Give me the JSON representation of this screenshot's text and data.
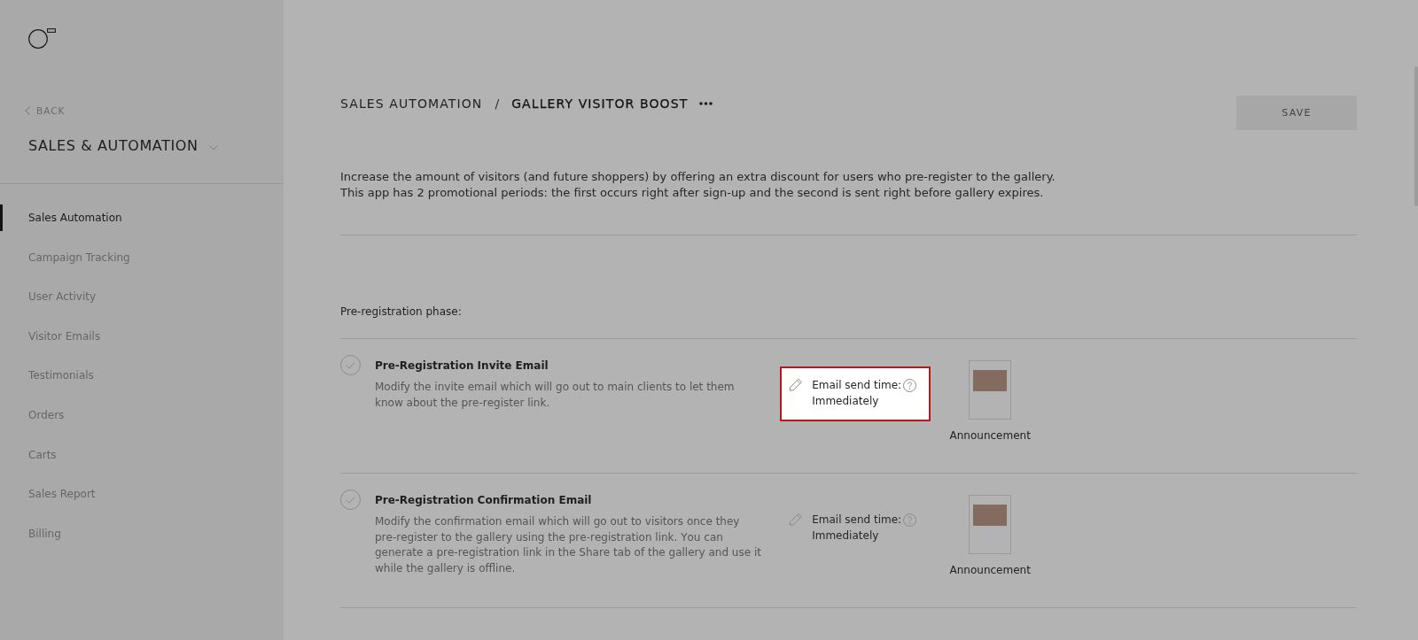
{
  "sidebar": {
    "back_link": "BACK",
    "title": "SALES & AUTOMATION",
    "items": [
      {
        "label": "Sales Automation",
        "selected": true
      },
      {
        "label": "Campaign Tracking",
        "selected": false
      },
      {
        "label": "User Activity",
        "selected": false
      },
      {
        "label": "Visitor Emails",
        "selected": false
      },
      {
        "label": "Testimonials",
        "selected": false
      },
      {
        "label": "Orders",
        "selected": false
      },
      {
        "label": "Carts",
        "selected": false
      },
      {
        "label": "Sales Report",
        "selected": false
      },
      {
        "label": "Billing",
        "selected": false
      }
    ]
  },
  "header": {
    "breadcrumb": [
      "SALES AUTOMATION",
      "GALLERY VISITOR BOOST"
    ],
    "separator": "/",
    "save_button": "SAVE"
  },
  "description": [
    "Increase the amount of visitors (and future shoppers) by offering an extra discount for users who pre-register to the gallery.",
    "This app has 2 promotional periods: the first occurs right after sign-up and the second is sent right before gallery expires."
  ],
  "phase": {
    "title": "Pre-registration phase:",
    "emails": [
      {
        "title": "Pre-Registration Invite Email",
        "description": "Modify the invite email which will go out to main clients to let them know about the pre-register link.",
        "send_time_label": "Email send time:",
        "send_time": "Immediately",
        "template": "Announcement",
        "highlighted": true
      },
      {
        "title": "Pre-Registration Confirmation Email",
        "description": "Modify the confirmation email which will go out to visitors once they pre-register to the gallery using the pre-registration link. You can generate a pre-registration link in the Share tab of the gallery and use it while the gallery is offline.",
        "send_time_label": "Email send time:",
        "send_time": "Immediately",
        "template": "Announcement",
        "highlighted": false
      }
    ]
  }
}
